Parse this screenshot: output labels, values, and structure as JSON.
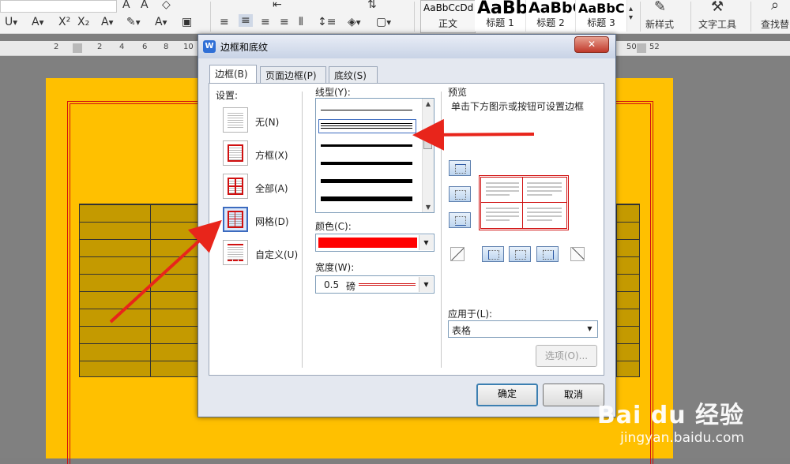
{
  "ribbon": {
    "styles": [
      {
        "sample": "AaBbCcDd",
        "name": "正文",
        "size": 12,
        "bold": false
      },
      {
        "sample": "AaBb",
        "name": "标题 1",
        "size": 22,
        "bold": true
      },
      {
        "sample": "AaBbC",
        "name": "标题 2",
        "size": 19,
        "bold": true
      },
      {
        "sample": "AaBbC",
        "name": "标题 3",
        "size": 16,
        "bold": true
      }
    ],
    "new_style": "新样式",
    "text_tools": "文字工具",
    "find_replace": "查找替"
  },
  "ruler": {
    "marks": [
      "2",
      "2",
      "4",
      "6",
      "8",
      "10",
      "50",
      "52"
    ]
  },
  "dialog": {
    "title": "边框和底纹",
    "tabs": [
      "边框(B)",
      "页面边框(P)",
      "底纹(S)"
    ],
    "settings_label": "设置:",
    "settings": [
      {
        "label": "无(N)",
        "icon": "none-border-icon"
      },
      {
        "label": "方框(X)",
        "icon": "box-border-icon"
      },
      {
        "label": "全部(A)",
        "icon": "all-border-icon"
      },
      {
        "label": "网格(D)",
        "icon": "grid-border-icon"
      },
      {
        "label": "自定义(U)",
        "icon": "custom-border-icon"
      }
    ],
    "selected_setting": 3,
    "line_style_label": "线型(Y):",
    "color_label": "颜色(C):",
    "color_value": "#ff0000",
    "width_label": "宽度(W):",
    "width_value": "0.5",
    "width_unit": "磅",
    "preview_label": "预览",
    "preview_hint": "单击下方图示或按钮可设置边框",
    "apply_to_label": "应用于(L):",
    "apply_to_value": "表格",
    "options_button": "选项(O)...",
    "ok_button": "确定",
    "cancel_button": "取消"
  },
  "watermark": {
    "line1": "Bai du 经验",
    "line2": "jingyan.baidu.com"
  },
  "colors": {
    "page": "#ffc000",
    "border_red": "#d01010",
    "table": "#c49a00",
    "arrow": "#e8251b"
  }
}
